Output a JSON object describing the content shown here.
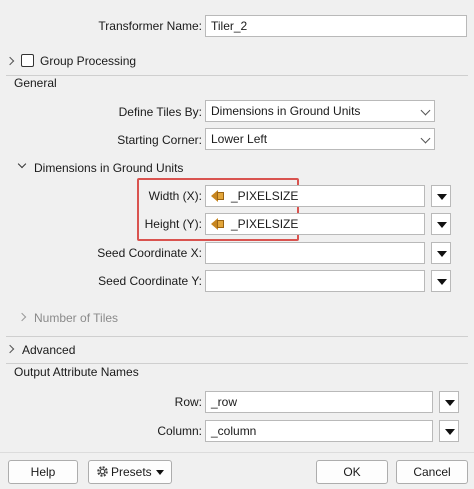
{
  "transformer": {
    "name_label": "Transformer Name:",
    "name_value": "Tiler_2"
  },
  "group_processing": {
    "label": "Group Processing",
    "checked": false
  },
  "general": {
    "title": "General",
    "define_tiles_label": "Define Tiles By:",
    "define_tiles_value": "Dimensions in Ground Units",
    "starting_corner_label": "Starting Corner:",
    "starting_corner_value": "Lower Left"
  },
  "dimensions": {
    "title": "Dimensions in Ground Units",
    "width_label": "Width (X):",
    "width_value": "_PIXELSIZE",
    "height_label": "Height (Y):",
    "height_value": "_PIXELSIZE",
    "seed_x_label": "Seed Coordinate X:",
    "seed_x_value": "",
    "seed_y_label": "Seed Coordinate Y:",
    "seed_y_value": "",
    "highlight_color": "#d9534f"
  },
  "number_of_tiles": {
    "title": "Number of Tiles"
  },
  "advanced": {
    "title": "Advanced"
  },
  "output": {
    "title": "Output Attribute Names",
    "row_label": "Row:",
    "row_value": "_row",
    "column_label": "Column:",
    "column_value": "_column"
  },
  "footer": {
    "help_label": "Help",
    "presets_label": "Presets",
    "ok_label": "OK",
    "cancel_label": "Cancel"
  },
  "icons": {
    "parameter": "attribute-value-icon",
    "gear": "gear-icon"
  }
}
